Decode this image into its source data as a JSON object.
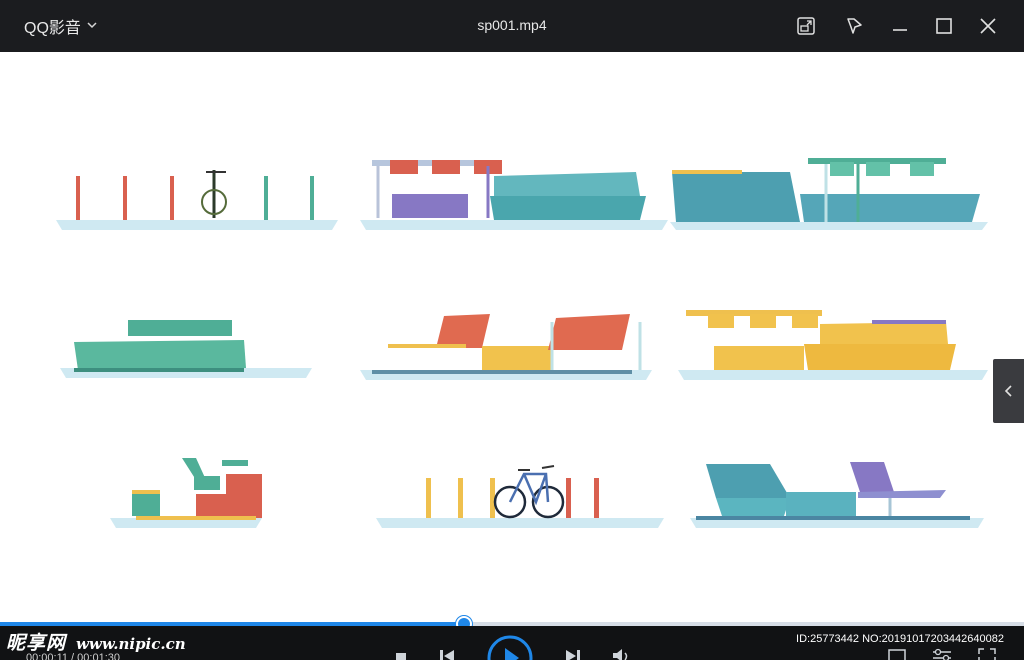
{
  "titlebar": {
    "app_name": "QQ影音",
    "file_name": "sp001.mp4"
  },
  "icons": {
    "app_menu": "chevron-down-icon",
    "mini_mode": "mini-mode-icon",
    "pin_top": "pin-icon",
    "minimize": "minimize-icon",
    "maximize": "maximize-icon",
    "close": "close-icon",
    "side_panel": "chevron-left-icon",
    "stop": "stop-icon",
    "prev": "previous-icon",
    "play": "play-icon",
    "next": "next-icon",
    "volume": "volume-icon",
    "screenshot": "screenshot-icon",
    "settings": "settings-icon",
    "fullscreen": "fullscreen-icon"
  },
  "playback": {
    "elapsed": "00:00:11",
    "total": "00:01:30",
    "time_text": "00:00:11 / 00:01:30",
    "progress_fraction": 0.453
  },
  "watermark": {
    "site_cn": "昵享网",
    "site_url": "www.nipic.cn",
    "id_text": "ID:25773442 NO:20191017203442640082"
  },
  "colors": {
    "titlebar_bg": "#1b1c1f",
    "controlbar_bg": "#111214",
    "accent": "#1f87e8",
    "red": "#d9604f",
    "teal": "#5bb5b9",
    "green": "#4fae96",
    "yellow": "#efc04e",
    "purple": "#8778c4",
    "blue": "#6fb0cf"
  }
}
